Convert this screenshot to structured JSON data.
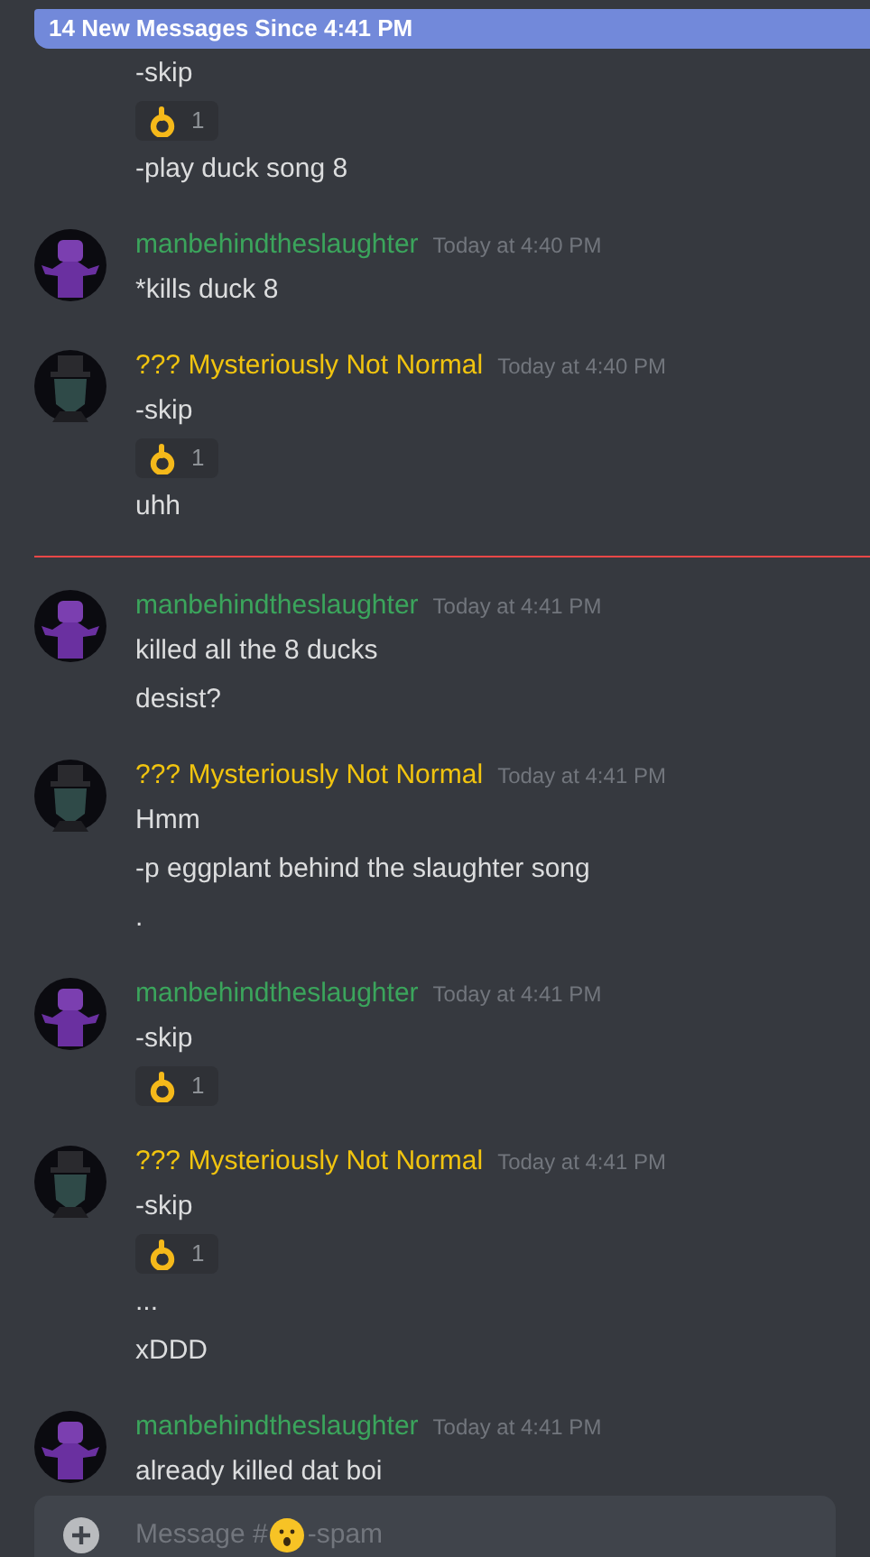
{
  "banner": {
    "text": "14 New Messages Since 4:41 PM"
  },
  "messages": [
    {
      "kind": "message",
      "lines": [
        {
          "kind": "text",
          "text": "-skip"
        },
        {
          "kind": "reaction",
          "count": "1"
        },
        {
          "kind": "text",
          "text": "-play duck song 8"
        }
      ]
    },
    {
      "kind": "message",
      "author": {
        "name": "manbehindtheslaughter",
        "color": "#3ba55c",
        "kind": "purple"
      },
      "time": "Today at 4:40 PM",
      "lines": [
        {
          "kind": "text",
          "text": "*kills duck 8"
        }
      ]
    },
    {
      "kind": "message",
      "author": {
        "name": "??? Mysteriously Not Normal",
        "color": "#f1c40f",
        "kind": "hat"
      },
      "time": "Today at 4:40 PM",
      "lines": [
        {
          "kind": "text",
          "text": "-skip"
        },
        {
          "kind": "reaction",
          "count": "1"
        },
        {
          "kind": "text",
          "text": "uhh"
        }
      ]
    },
    {
      "kind": "divider"
    },
    {
      "kind": "message",
      "author": {
        "name": "manbehindtheslaughter",
        "color": "#3ba55c",
        "kind": "purple"
      },
      "time": "Today at 4:41 PM",
      "lines": [
        {
          "kind": "text",
          "text": "killed all the 8 ducks"
        },
        {
          "kind": "text",
          "text": "desist?"
        }
      ]
    },
    {
      "kind": "message",
      "author": {
        "name": "??? Mysteriously Not Normal",
        "color": "#f1c40f",
        "kind": "hat"
      },
      "time": "Today at 4:41 PM",
      "lines": [
        {
          "kind": "text",
          "text": "Hmm"
        },
        {
          "kind": "text",
          "text": "-p eggplant behind the slaughter song"
        },
        {
          "kind": "text",
          "text": "."
        }
      ]
    },
    {
      "kind": "message",
      "author": {
        "name": "manbehindtheslaughter",
        "color": "#3ba55c",
        "kind": "purple"
      },
      "time": "Today at 4:41 PM",
      "lines": [
        {
          "kind": "text",
          "text": "-skip"
        },
        {
          "kind": "reaction",
          "count": "1"
        }
      ]
    },
    {
      "kind": "message",
      "author": {
        "name": "??? Mysteriously Not Normal",
        "color": "#f1c40f",
        "kind": "hat"
      },
      "time": "Today at 4:41 PM",
      "lines": [
        {
          "kind": "text",
          "text": "-skip"
        },
        {
          "kind": "reaction",
          "count": "1"
        },
        {
          "kind": "text",
          "text": "..."
        },
        {
          "kind": "text",
          "text": "xDDD"
        }
      ]
    },
    {
      "kind": "message",
      "author": {
        "name": "manbehindtheslaughter",
        "color": "#3ba55c",
        "kind": "purple"
      },
      "time": "Today at 4:41 PM",
      "lines": [
        {
          "kind": "text",
          "text": "already killed dat boi"
        }
      ]
    }
  ],
  "composer": {
    "placeholder": "Message #",
    "channel_suffix": "-spam"
  }
}
